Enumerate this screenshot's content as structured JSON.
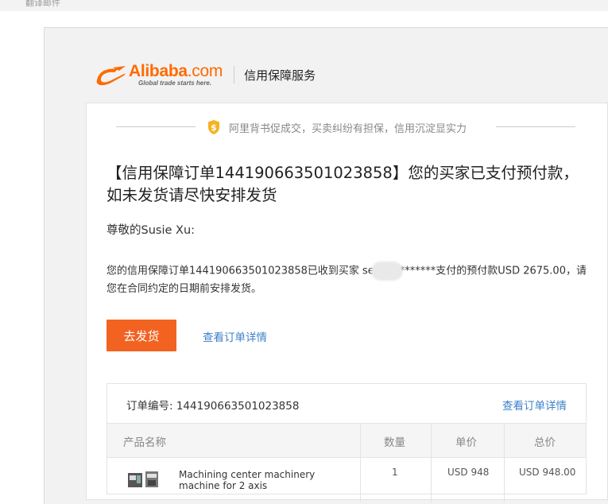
{
  "top": {
    "label": "翻译邮件"
  },
  "header": {
    "logo_main": "Alibaba",
    "logo_dotcom": ".com",
    "logo_tagline": "Global trade starts here.",
    "service_title": "信用保障服务"
  },
  "slogan": "阿里背书促成交，买卖纠纷有担保，信用沉淀显实力",
  "headline": "【信用保障订单144190663501023858】您的买家已支付预付款，如未发货请尽快安排发货",
  "greeting": "尊敬的Susie Xu:",
  "body": {
    "part1": "您的信用保障订单144190663501023858已收到买家 se",
    "part2": "*******支付的预付款USD 2675.00，请您在合同约定的日期前安排发货。"
  },
  "actions": {
    "ship_button": "去发货",
    "view_detail": "查看订单详情"
  },
  "order": {
    "number_label": "订单编号: 144190663501023858",
    "view_detail": "查看订单详情",
    "columns": [
      "产品名称",
      "数量",
      "单价",
      "总价"
    ],
    "rows": [
      {
        "name": "Machining center machinery machine for 2 axis",
        "qty": "1",
        "unit_price": "USD 948",
        "total": "USD 948.00"
      }
    ]
  },
  "colors": {
    "brand": "#ff6a00",
    "button": "#f26322",
    "link": "#3e80c8"
  }
}
